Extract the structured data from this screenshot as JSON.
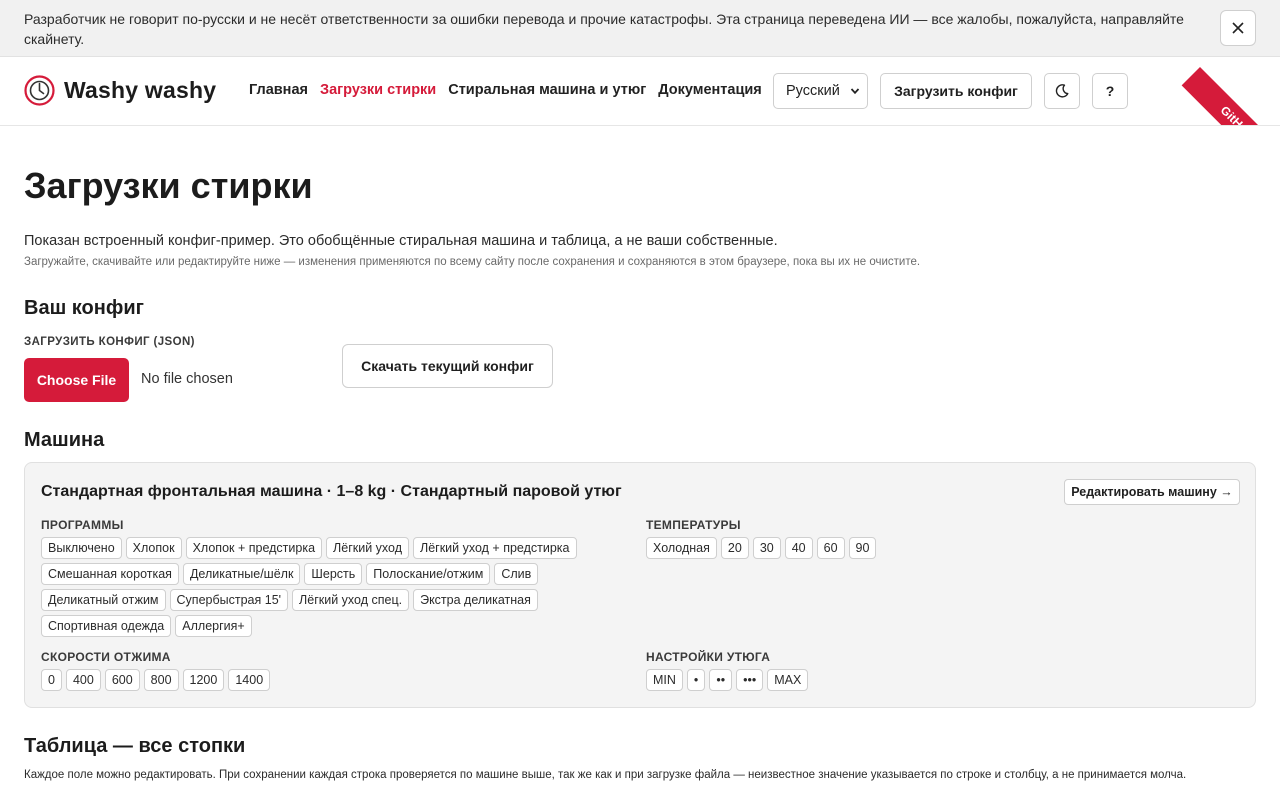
{
  "banner": {
    "text": "Разработчик не говорит по-русски и не несёт ответственности за ошибки перевода и прочие катастрофы. Эта страница переведена ИИ — все жалобы, пожалуйста, направляйте скайнету.",
    "close_icon": "×"
  },
  "header": {
    "logo_text": "Washy washy",
    "nav": [
      {
        "label": "Главная",
        "active": false
      },
      {
        "label": "Загрузки стирки",
        "active": true
      },
      {
        "label": "Стиральная машина и утюг",
        "active": false
      },
      {
        "label": "Документация",
        "active": false
      }
    ],
    "language": "Русский",
    "upload_button": "Загрузить конфиг",
    "help_button": "?",
    "github_ribbon": "GitHub"
  },
  "page": {
    "title": "Загрузки стирки",
    "lead": "Показан встроенный конфиг-пример. Это обобщённые стиральная машина и таблица, а не ваши собственные.",
    "sublead": "Загружайте, скачивайте или редактируйте ниже — изменения применяются по всему сайту после сохранения и сохраняются в этом браузере, пока вы их не очистите."
  },
  "config": {
    "heading": "Ваш конфиг",
    "upload_label": "ЗАГРУЗИТЬ КОНФИГ (JSON)",
    "choose_file": "Choose File",
    "no_file": "No file chosen",
    "download_button": "Скачать текущий конфиг"
  },
  "machine": {
    "heading": "Машина",
    "title": "Стандартная фронтальная машина · 1–8 kg · Стандартный паровой утюг",
    "edit_button": "Редактировать машину →",
    "programs_label": "ПРОГРАММЫ",
    "programs": [
      "Выключено",
      "Хлопок",
      "Хлопок + предстирка",
      "Лёгкий уход",
      "Лёгкий уход + предстирка",
      "Смешанная короткая",
      "Деликатные/шёлк",
      "Шерсть",
      "Полоскание/отжим",
      "Слив",
      "Деликатный отжим",
      "Супербыстрая 15'",
      "Лёгкий уход спец.",
      "Экстра деликатная",
      "Спортивная одежда",
      "Аллергия+"
    ],
    "temperatures_label": "ТЕМПЕРАТУРЫ",
    "temperatures": [
      "Холодная",
      "20",
      "30",
      "40",
      "60",
      "90"
    ],
    "spins_label": "СКОРОСТИ ОТЖИМА",
    "spins": [
      "0",
      "400",
      "600",
      "800",
      "1200",
      "1400"
    ],
    "iron_label": "НАСТРОЙКИ УТЮГА",
    "iron": [
      "MIN",
      "•",
      "••",
      "•••",
      "MAX"
    ]
  },
  "table": {
    "heading": "Таблица — все стопки",
    "intro": "Каждое поле можно редактировать. При сохранении каждая строка проверяется по машине выше, так же как и при загрузке файла — неизвестное значение указывается по строке и столбцу, а не принимается молча."
  },
  "colors": {
    "accent": "#d51b3a"
  }
}
